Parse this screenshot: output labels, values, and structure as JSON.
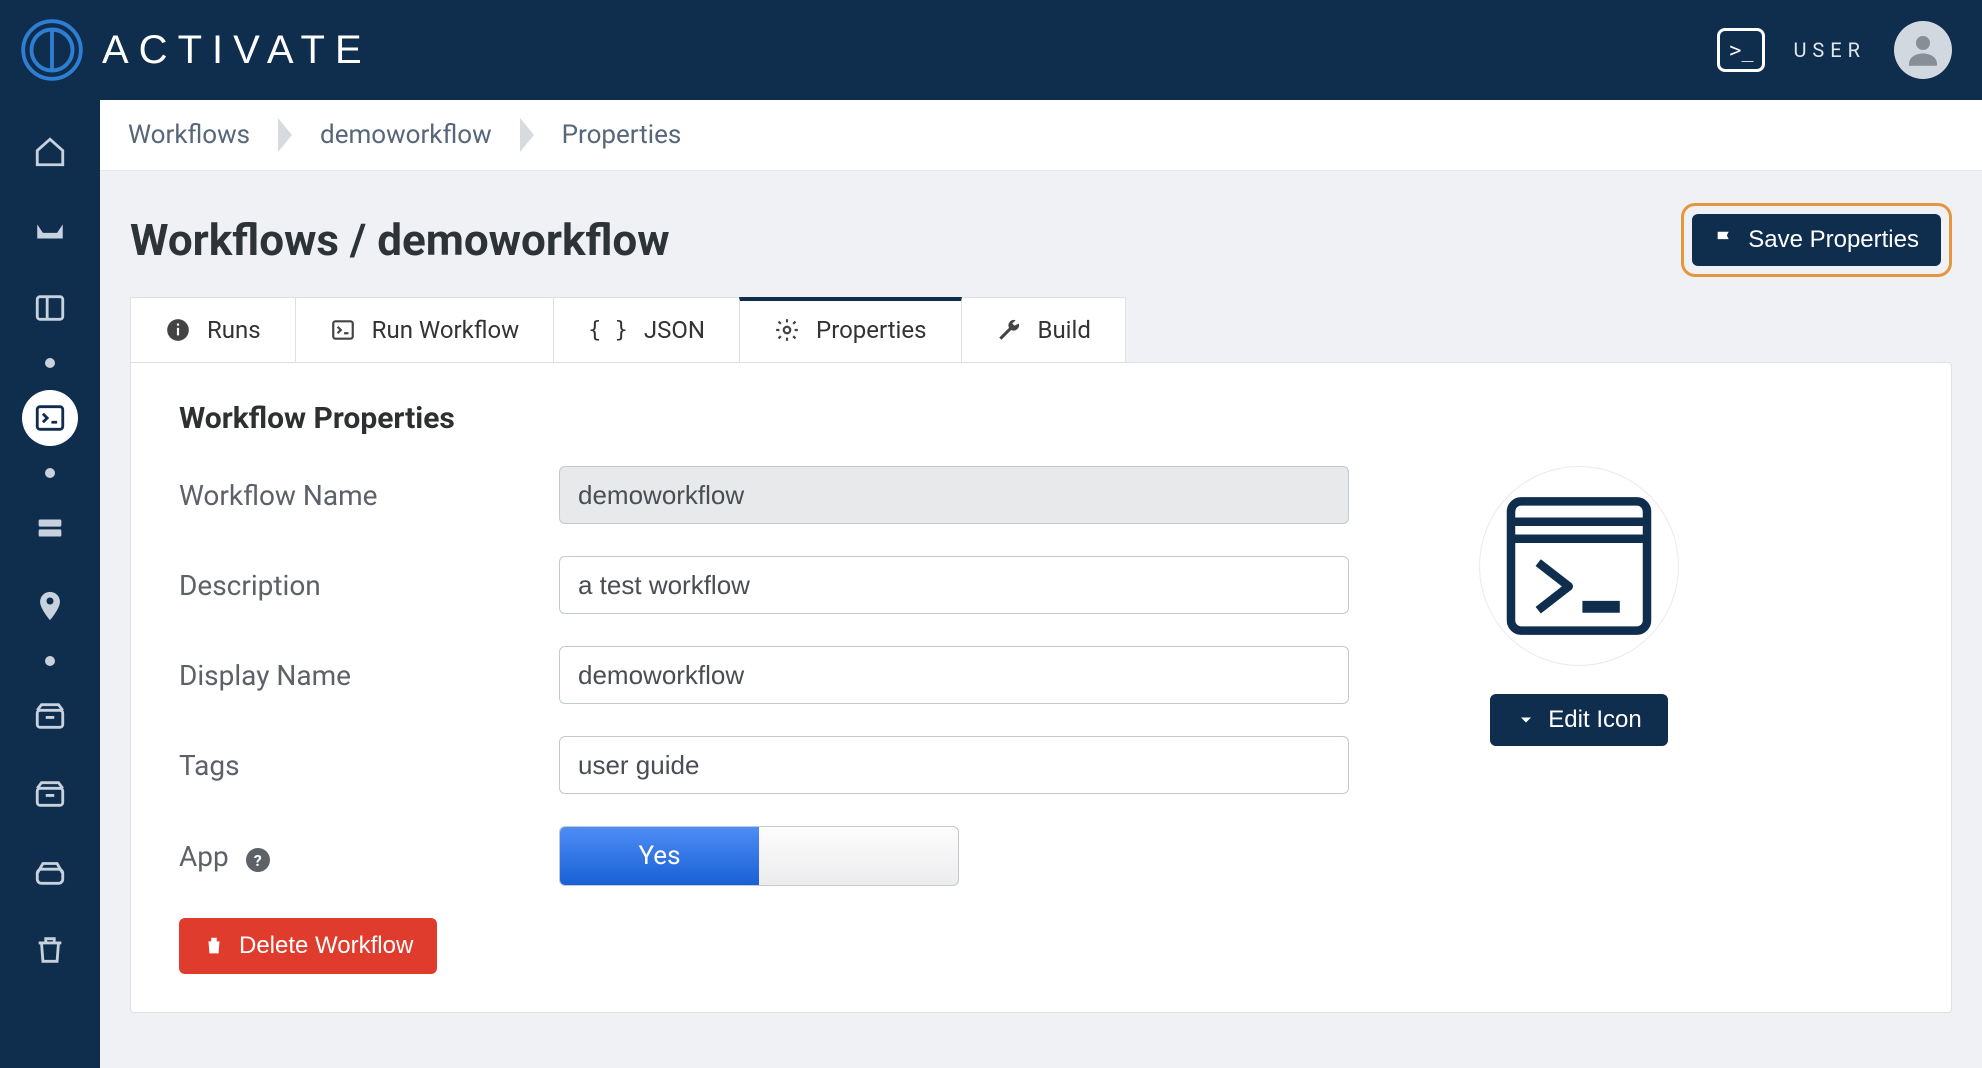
{
  "header": {
    "brand": "ACTIVATE",
    "user_label": "USER"
  },
  "breadcrumb": {
    "items": [
      "Workflows",
      "demoworkflow",
      "Properties"
    ]
  },
  "page": {
    "title": "Workflows / demoworkflow",
    "save_label": "Save Properties"
  },
  "tabs": [
    {
      "label": "Runs",
      "active": false
    },
    {
      "label": "Run Workflow",
      "active": false
    },
    {
      "label": "JSON",
      "active": false
    },
    {
      "label": "Properties",
      "active": true
    },
    {
      "label": "Build",
      "active": false
    }
  ],
  "panel": {
    "heading": "Workflow Properties",
    "fields": {
      "workflow_name_label": "Workflow Name",
      "workflow_name_value": "demoworkflow",
      "description_label": "Description",
      "description_value": "a test workflow",
      "display_name_label": "Display Name",
      "display_name_value": "demoworkflow",
      "tags_label": "Tags",
      "tags_value": "user guide",
      "app_label": "App",
      "app_toggle_value": "Yes"
    },
    "edit_icon_label": "Edit Icon",
    "delete_label": "Delete Workflow"
  }
}
